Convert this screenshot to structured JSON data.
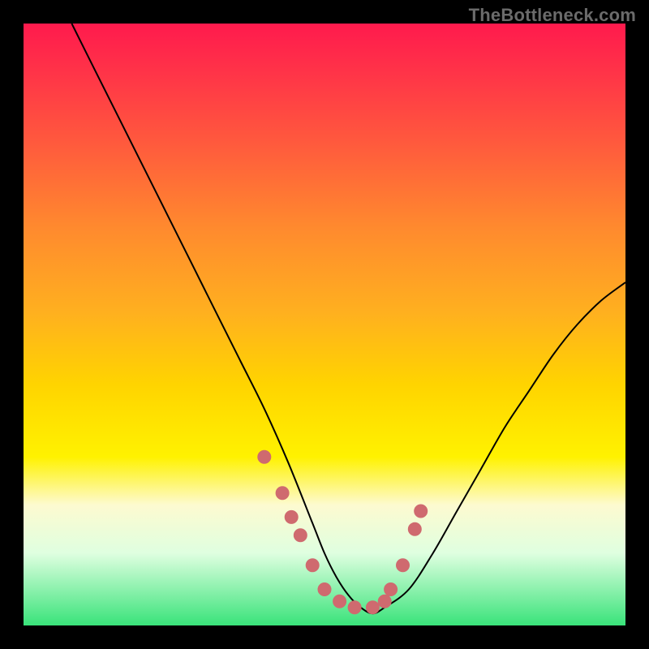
{
  "watermark": "TheBottleneck.com",
  "colors": {
    "page_bg": "#000000",
    "gradient_top": "#ff1a4d",
    "gradient_bottom": "#39e37a",
    "curve_stroke": "#000000",
    "marker_fill": "#cf6a6f",
    "watermark_text": "#6b6b6b"
  },
  "chart_data": {
    "type": "line",
    "title": "",
    "xlabel": "",
    "ylabel": "",
    "xlim": [
      0,
      100
    ],
    "ylim": [
      0,
      100
    ],
    "grid": false,
    "series": [
      {
        "name": "bottleneck-curve",
        "x": [
          8,
          12,
          16,
          20,
          24,
          28,
          32,
          36,
          40,
          44,
          48,
          50,
          52,
          54,
          56,
          58,
          60,
          64,
          68,
          72,
          76,
          80,
          84,
          88,
          92,
          96,
          100
        ],
        "y": [
          100,
          92,
          84,
          76,
          68,
          60,
          52,
          44,
          36,
          27,
          17,
          12,
          8,
          5,
          3,
          2,
          3,
          6,
          12,
          19,
          26,
          33,
          39,
          45,
          50,
          54,
          57
        ]
      }
    ],
    "markers": {
      "name": "highlight-points",
      "x": [
        40,
        43,
        44.5,
        46,
        48,
        50,
        52.5,
        55,
        58,
        60,
        61,
        63,
        65,
        66
      ],
      "y": [
        28,
        22,
        18,
        15,
        10,
        6,
        4,
        3,
        3,
        4,
        6,
        10,
        16,
        19
      ]
    }
  }
}
